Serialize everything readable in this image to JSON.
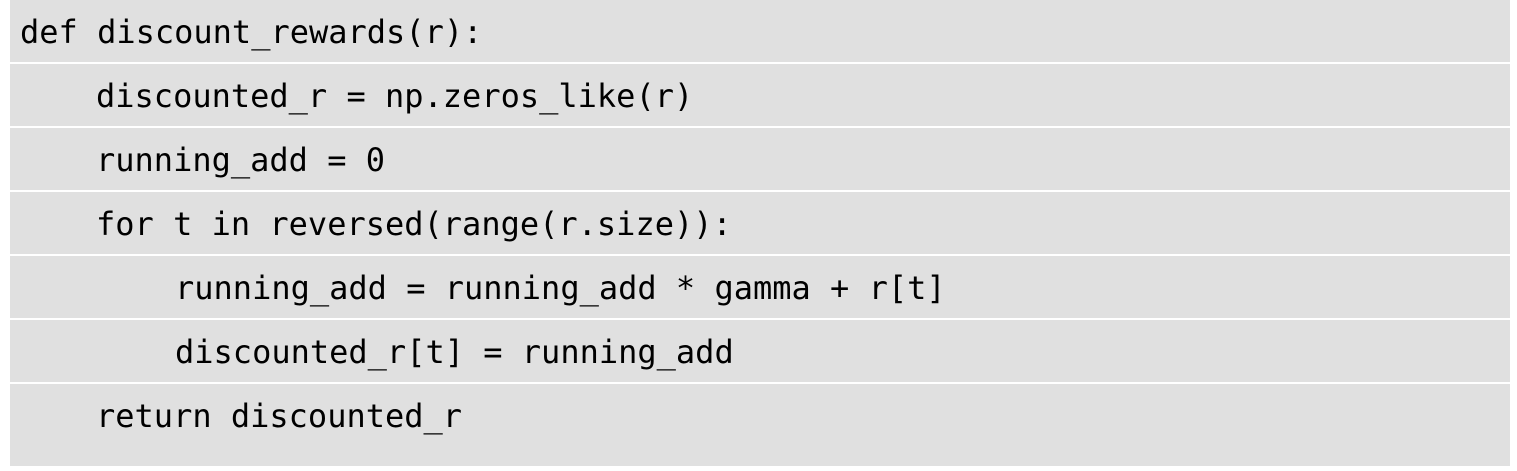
{
  "code": {
    "lines": [
      "def discount_rewards(r):",
      "discounted_r = np.zeros_like(r)",
      "running_add = 0",
      "for t in reversed(range(r.size)):",
      "running_add = running_add * gamma + r[t]",
      "discounted_r[t] = running_add",
      "return discounted_r"
    ]
  }
}
